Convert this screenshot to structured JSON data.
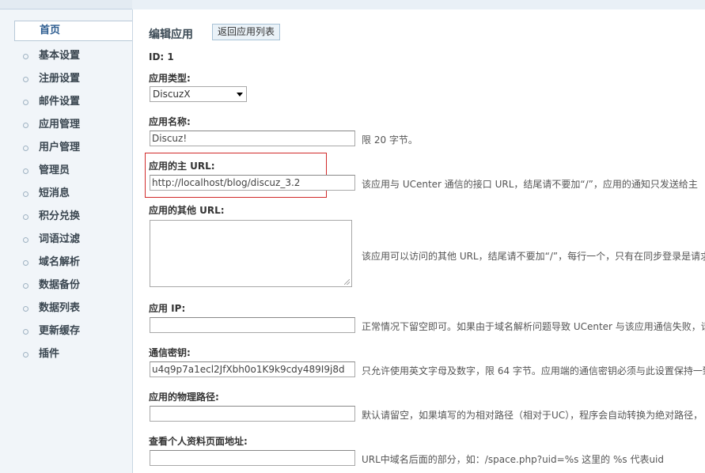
{
  "sidebar": {
    "items": [
      {
        "label": "首页"
      },
      {
        "label": "基本设置"
      },
      {
        "label": "注册设置"
      },
      {
        "label": "邮件设置"
      },
      {
        "label": "应用管理"
      },
      {
        "label": "用户管理"
      },
      {
        "label": "管理员"
      },
      {
        "label": "短消息"
      },
      {
        "label": "积分兑换"
      },
      {
        "label": "词语过滤"
      },
      {
        "label": "域名解析"
      },
      {
        "label": "数据备份"
      },
      {
        "label": "数据列表"
      },
      {
        "label": "更新缓存"
      },
      {
        "label": "插件"
      }
    ]
  },
  "main": {
    "title": "编辑应用",
    "back_button": "返回应用列表",
    "id_label": "ID: 1",
    "app_type": {
      "label": "应用类型:",
      "value": "DiscuzX"
    },
    "app_name": {
      "label": "应用名称:",
      "value": "Discuz!",
      "hint": "限 20 字节。"
    },
    "main_url": {
      "label": "应用的主 URL:",
      "value": "http://localhost/blog/discuz_3.2",
      "hint": "该应用与 UCenter 通信的接口 URL，结尾请不要加“/”，应用的通知只发送给主"
    },
    "other_url": {
      "label": "应用的其他 URL:",
      "value": "",
      "hint": "该应用可以访问的其他 URL，结尾请不要加“/”，每行一个，只有在同步登录是请求"
    },
    "app_ip": {
      "label": "应用 IP:",
      "value": "",
      "hint": "正常情况下留空即可。如果由于域名解析问题导致 UCenter 与该应用通信失败，请"
    },
    "comm_key": {
      "label": "通信密钥:",
      "value": "u4q9p7a1ecl2JfXbh0o1K9k9cdy489I9j8d",
      "hint": "只允许使用英文字母及数字，限 64 字节。应用端的通信密钥必须与此设置保持一致"
    },
    "physical_path": {
      "label": "应用的物理路径:",
      "value": "",
      "hint": "默认请留空，如果填写的为相对路径（相对于UC），程序会自动转换为绝对路径，"
    },
    "profile_url": {
      "label": "查看个人资料页面地址:",
      "value": "",
      "hint": "URL中域名后面的部分，如：/space.php?uid=%s 这里的 %s 代表uid"
    }
  }
}
